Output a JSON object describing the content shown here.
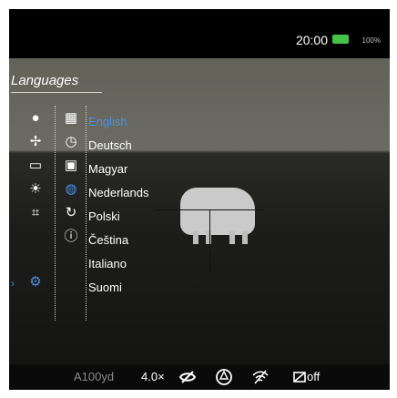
{
  "header": {
    "time": "20:00",
    "battery_percent": "100%"
  },
  "menu": {
    "title": "Languages",
    "languages": [
      "English",
      "Deutsch",
      "Magyar",
      "Nederlands",
      "Polski",
      "Čeština",
      "Italiano",
      "Suomi"
    ]
  },
  "status": {
    "range": "A100yd",
    "zoom": "4.0×",
    "record_label": "off"
  },
  "icons": {
    "left": [
      "microphone-icon",
      "crosshair-icon",
      "display-off-icon",
      "brightness-icon",
      "zoom-frame-icon",
      "settings-gear-icon"
    ],
    "right": [
      "calendar-icon",
      "clock-icon",
      "image-icon",
      "globe-icon",
      "reset-icon",
      "info-icon"
    ]
  },
  "colors": {
    "accent": "#4a90e2",
    "battery": "#46c24b"
  }
}
